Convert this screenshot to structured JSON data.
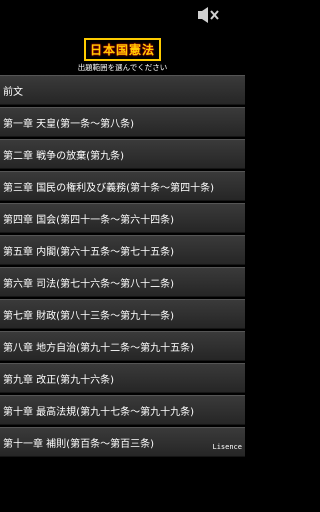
{
  "header": {
    "mute_icon": "speaker-mute-icon",
    "title": "日本国憲法",
    "subtitle": "出題範囲を選んでください"
  },
  "chapters": [
    {
      "label": "前文"
    },
    {
      "label": "第一章  天皇(第一条〜第八条)"
    },
    {
      "label": "第二章  戦争の放棄(第九条)"
    },
    {
      "label": "第三章  国民の権利及び義務(第十条〜第四十条)"
    },
    {
      "label": "第四章  国会(第四十一条〜第六十四条)"
    },
    {
      "label": "第五章  内閣(第六十五条〜第七十五条)"
    },
    {
      "label": "第六章  司法(第七十六条〜第八十二条)"
    },
    {
      "label": "第七章  財政(第八十三条〜第九十一条)"
    },
    {
      "label": "第八章  地方自治(第九十二条〜第九十五条)"
    },
    {
      "label": "第九章  改正(第九十六条)"
    },
    {
      "label": "第十章  最高法規(第九十七条〜第九十九条)"
    },
    {
      "label": "第十一章  補則(第百条〜第百三条)"
    }
  ],
  "footer": {
    "license_link": "Lisence"
  }
}
